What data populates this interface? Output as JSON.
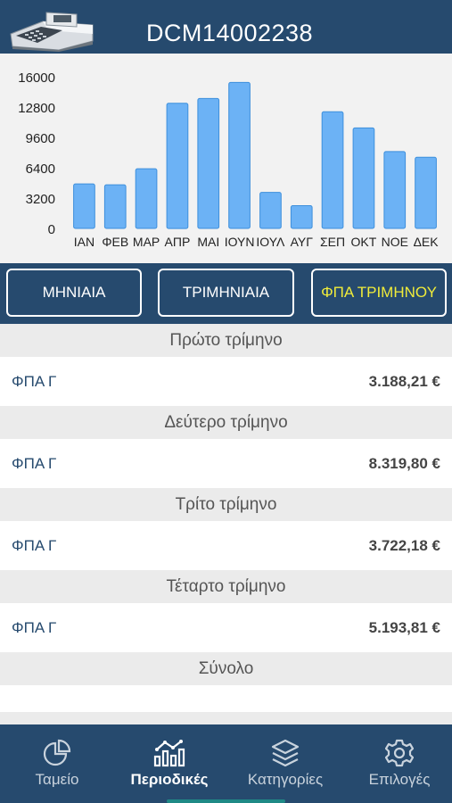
{
  "header": {
    "title": "DCM14002238",
    "icon": "cash-register-icon"
  },
  "chart_data": {
    "type": "bar",
    "categories": [
      "ΙΑΝ",
      "ΦΕΒ",
      "ΜΑΡ",
      "ΑΠΡ",
      "ΜΑΙ",
      "ΙΟΥΝ",
      "ΙΟΥΛ",
      "ΑΥΓ",
      "ΣΕΠ",
      "ΟΚΤ",
      "ΝΟΕ",
      "ΔΕΚ"
    ],
    "values": [
      4700,
      4600,
      6300,
      13200,
      13700,
      15400,
      3800,
      2400,
      12300,
      10600,
      8100,
      7500
    ],
    "yticks": [
      "0",
      "3200",
      "6400",
      "9600",
      "12800",
      "16000"
    ],
    "ylim": [
      0,
      16000
    ],
    "grid": false,
    "bar_color": "#6cb2f5"
  },
  "tabs": [
    {
      "label": "ΜΗΝΙΑΙΑ",
      "active": false
    },
    {
      "label": "ΤΡΙΜΗΝΙΑΙΑ",
      "active": false
    },
    {
      "label": "ΦΠΑ ΤΡΙΜΗΝΟΥ",
      "active": true
    }
  ],
  "sections": [
    {
      "title": "Πρώτο τρίμηνο",
      "label": "ΦΠΑ Γ",
      "value": "3.188,21 €"
    },
    {
      "title": "Δεύτερο τρίμηνο",
      "label": "ΦΠΑ Γ",
      "value": "8.319,80 €"
    },
    {
      "title": "Τρίτο τρίμηνο",
      "label": "ΦΠΑ Γ",
      "value": "3.722,18 €"
    },
    {
      "title": "Τέταρτο τρίμηνο",
      "label": "ΦΠΑ Γ",
      "value": "5.193,81 €"
    }
  ],
  "total": {
    "title": "Σύνολο"
  },
  "tabbar": [
    {
      "label": "Ταμείο",
      "icon": "pie-chart-icon",
      "active": false
    },
    {
      "label": "Περιοδικές",
      "icon": "bar-chart-icon",
      "active": true
    },
    {
      "label": "Κατηγορίες",
      "icon": "layers-icon",
      "active": false
    },
    {
      "label": "Επιλογές",
      "icon": "gear-icon",
      "active": false
    }
  ],
  "colors": {
    "primary": "#264a6e",
    "accent": "#f0ec3a",
    "bar": "#6cb2f5",
    "background": "#ebebeb"
  }
}
